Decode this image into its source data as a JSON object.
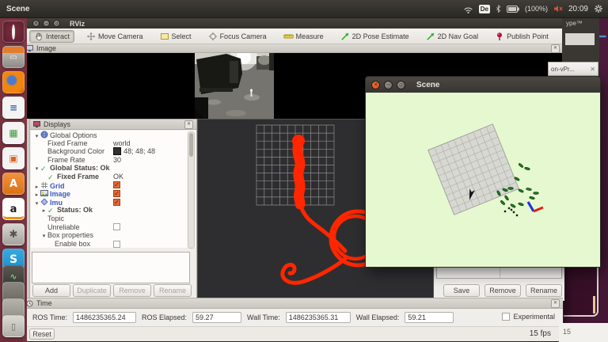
{
  "colors": {
    "desktop": "#4e1e3e",
    "accent-orange": "#e95420",
    "titlebar": "#45423d",
    "panel-bg": "#f0eeeb",
    "header-grad-top": "#dcd9d4",
    "header-grad-bottom": "#c9c5bf",
    "view-bg": "#2e2e30",
    "trajectory-red": "#ff2600",
    "scene-bg": "#e6f8d0",
    "display-blue": "#3c59c0",
    "status-green": "#36a23c",
    "checkbox-orange": "#dd6a3a"
  },
  "menubar": {
    "app_name": "Scene",
    "keyboard_layout": "De",
    "battery_label": "(100%)",
    "clock": "20:09"
  },
  "launcher": {
    "items": [
      {
        "id": "dash",
        "name": "ubuntu-dash"
      },
      {
        "id": "files",
        "name": "files"
      },
      {
        "id": "firefox",
        "name": "firefox"
      },
      {
        "id": "writer",
        "name": "libreoffice-writer"
      },
      {
        "id": "calc",
        "name": "libreoffice-calc"
      },
      {
        "id": "impress",
        "name": "libreoffice-impress"
      },
      {
        "id": "software",
        "name": "ubuntu-software"
      },
      {
        "id": "amazon",
        "name": "amazon"
      },
      {
        "id": "settings",
        "name": "system-settings"
      },
      {
        "id": "skype",
        "name": "skype"
      },
      {
        "id": "stack1",
        "name": "window-stack"
      },
      {
        "id": "stack2",
        "name": "window-stack"
      },
      {
        "id": "stack3",
        "name": "window-stack"
      },
      {
        "id": "trash",
        "name": "trash"
      }
    ]
  },
  "rviz": {
    "title": "RViz",
    "toolbar": {
      "tools": [
        {
          "label": "Interact",
          "icon": "hand",
          "active": true
        },
        {
          "label": "Move Camera",
          "icon": "move",
          "active": false
        },
        {
          "label": "Select",
          "icon": "select",
          "active": false
        },
        {
          "label": "Focus Camera",
          "icon": "focus",
          "active": false
        },
        {
          "label": "Measure",
          "icon": "measure",
          "active": false
        },
        {
          "label": "2D Pose Estimate",
          "icon": "pose-arrow",
          "active": false
        },
        {
          "label": "2D Nav Goal",
          "icon": "nav-arrow",
          "active": false
        },
        {
          "label": "Publish Point",
          "icon": "pin",
          "active": false
        }
      ]
    },
    "image_panel": {
      "title": "Image"
    },
    "displays_panel": {
      "title": "Displays",
      "rows": [
        {
          "ind": 0,
          "exp": "open",
          "icon": "globe",
          "label": "Global Options",
          "value": "",
          "cb": "",
          "bold": false,
          "blue": false,
          "swatch": false
        },
        {
          "ind": 1,
          "exp": "",
          "icon": "",
          "label": "Fixed Frame",
          "value": "world",
          "cb": "",
          "bold": false,
          "blue": false,
          "swatch": false
        },
        {
          "ind": 1,
          "exp": "",
          "icon": "",
          "label": "Background Color",
          "value": "48; 48; 48",
          "cb": "",
          "bold": false,
          "blue": false,
          "swatch": true
        },
        {
          "ind": 1,
          "exp": "",
          "icon": "",
          "label": "Frame Rate",
          "value": "30",
          "cb": "",
          "bold": false,
          "blue": false,
          "swatch": false
        },
        {
          "ind": 0,
          "exp": "open",
          "icon": "check",
          "label": "Global Status: Ok",
          "value": "",
          "cb": "",
          "bold": true,
          "blue": false,
          "swatch": false
        },
        {
          "ind": 1,
          "exp": "",
          "icon": "check",
          "label": "Fixed Frame",
          "value": "OK",
          "cb": "",
          "bold": true,
          "blue": false,
          "swatch": false
        },
        {
          "ind": 0,
          "exp": "closed",
          "icon": "grid",
          "label": "Grid",
          "value": "",
          "cb": "on",
          "bold": false,
          "blue": true,
          "swatch": false
        },
        {
          "ind": 0,
          "exp": "closed",
          "icon": "image",
          "label": "Image",
          "value": "",
          "cb": "on",
          "bold": false,
          "blue": true,
          "swatch": false
        },
        {
          "ind": 0,
          "exp": "open",
          "icon": "imu",
          "label": "Imu",
          "value": "",
          "cb": "on",
          "bold": false,
          "blue": true,
          "swatch": false
        },
        {
          "ind": 1,
          "exp": "closed",
          "icon": "check",
          "label": "Status: Ok",
          "value": "",
          "cb": "",
          "bold": true,
          "blue": false,
          "swatch": false
        },
        {
          "ind": 1,
          "exp": "",
          "icon": "",
          "label": "Topic",
          "value": "",
          "cb": "",
          "bold": false,
          "blue": false,
          "swatch": false
        },
        {
          "ind": 1,
          "exp": "",
          "icon": "",
          "label": "Unreliable",
          "value": "",
          "cb": "off",
          "bold": false,
          "blue": false,
          "swatch": false
        },
        {
          "ind": 1,
          "exp": "open",
          "icon": "",
          "label": "Box properties",
          "value": "",
          "cb": "",
          "bold": false,
          "blue": false,
          "swatch": false
        },
        {
          "ind": 2,
          "exp": "",
          "icon": "",
          "label": "Enable box",
          "value": "",
          "cb": "off",
          "bold": false,
          "blue": false,
          "swatch": false
        }
      ],
      "buttons": [
        {
          "label": "Add",
          "enabled": true
        },
        {
          "label": "Duplicate",
          "enabled": false
        },
        {
          "label": "Remove",
          "enabled": false
        },
        {
          "label": "Rename",
          "enabled": false
        }
      ]
    },
    "views_panel": {
      "buttons": [
        {
          "label": "Save",
          "enabled": true
        },
        {
          "label": "Remove",
          "enabled": true
        },
        {
          "label": "Rename",
          "enabled": true
        }
      ]
    },
    "time_panel": {
      "title": "Time",
      "fields": [
        {
          "label": "ROS Time:",
          "value": "1486235365.24"
        },
        {
          "label": "ROS Elapsed:",
          "value": "59.27"
        },
        {
          "label": "Wall Time:",
          "value": "1486235365.31"
        },
        {
          "label": "Wall Elapsed:",
          "value": "59.21"
        }
      ],
      "experimental_label": "Experimental",
      "reset_label": "Reset",
      "fps": "15 fps"
    }
  },
  "scene_window": {
    "title": "Scene"
  },
  "background_windows": {
    "top_fragment": "ype™",
    "tab_fragment": "on-vPr...",
    "bottom_fragment": "15"
  }
}
